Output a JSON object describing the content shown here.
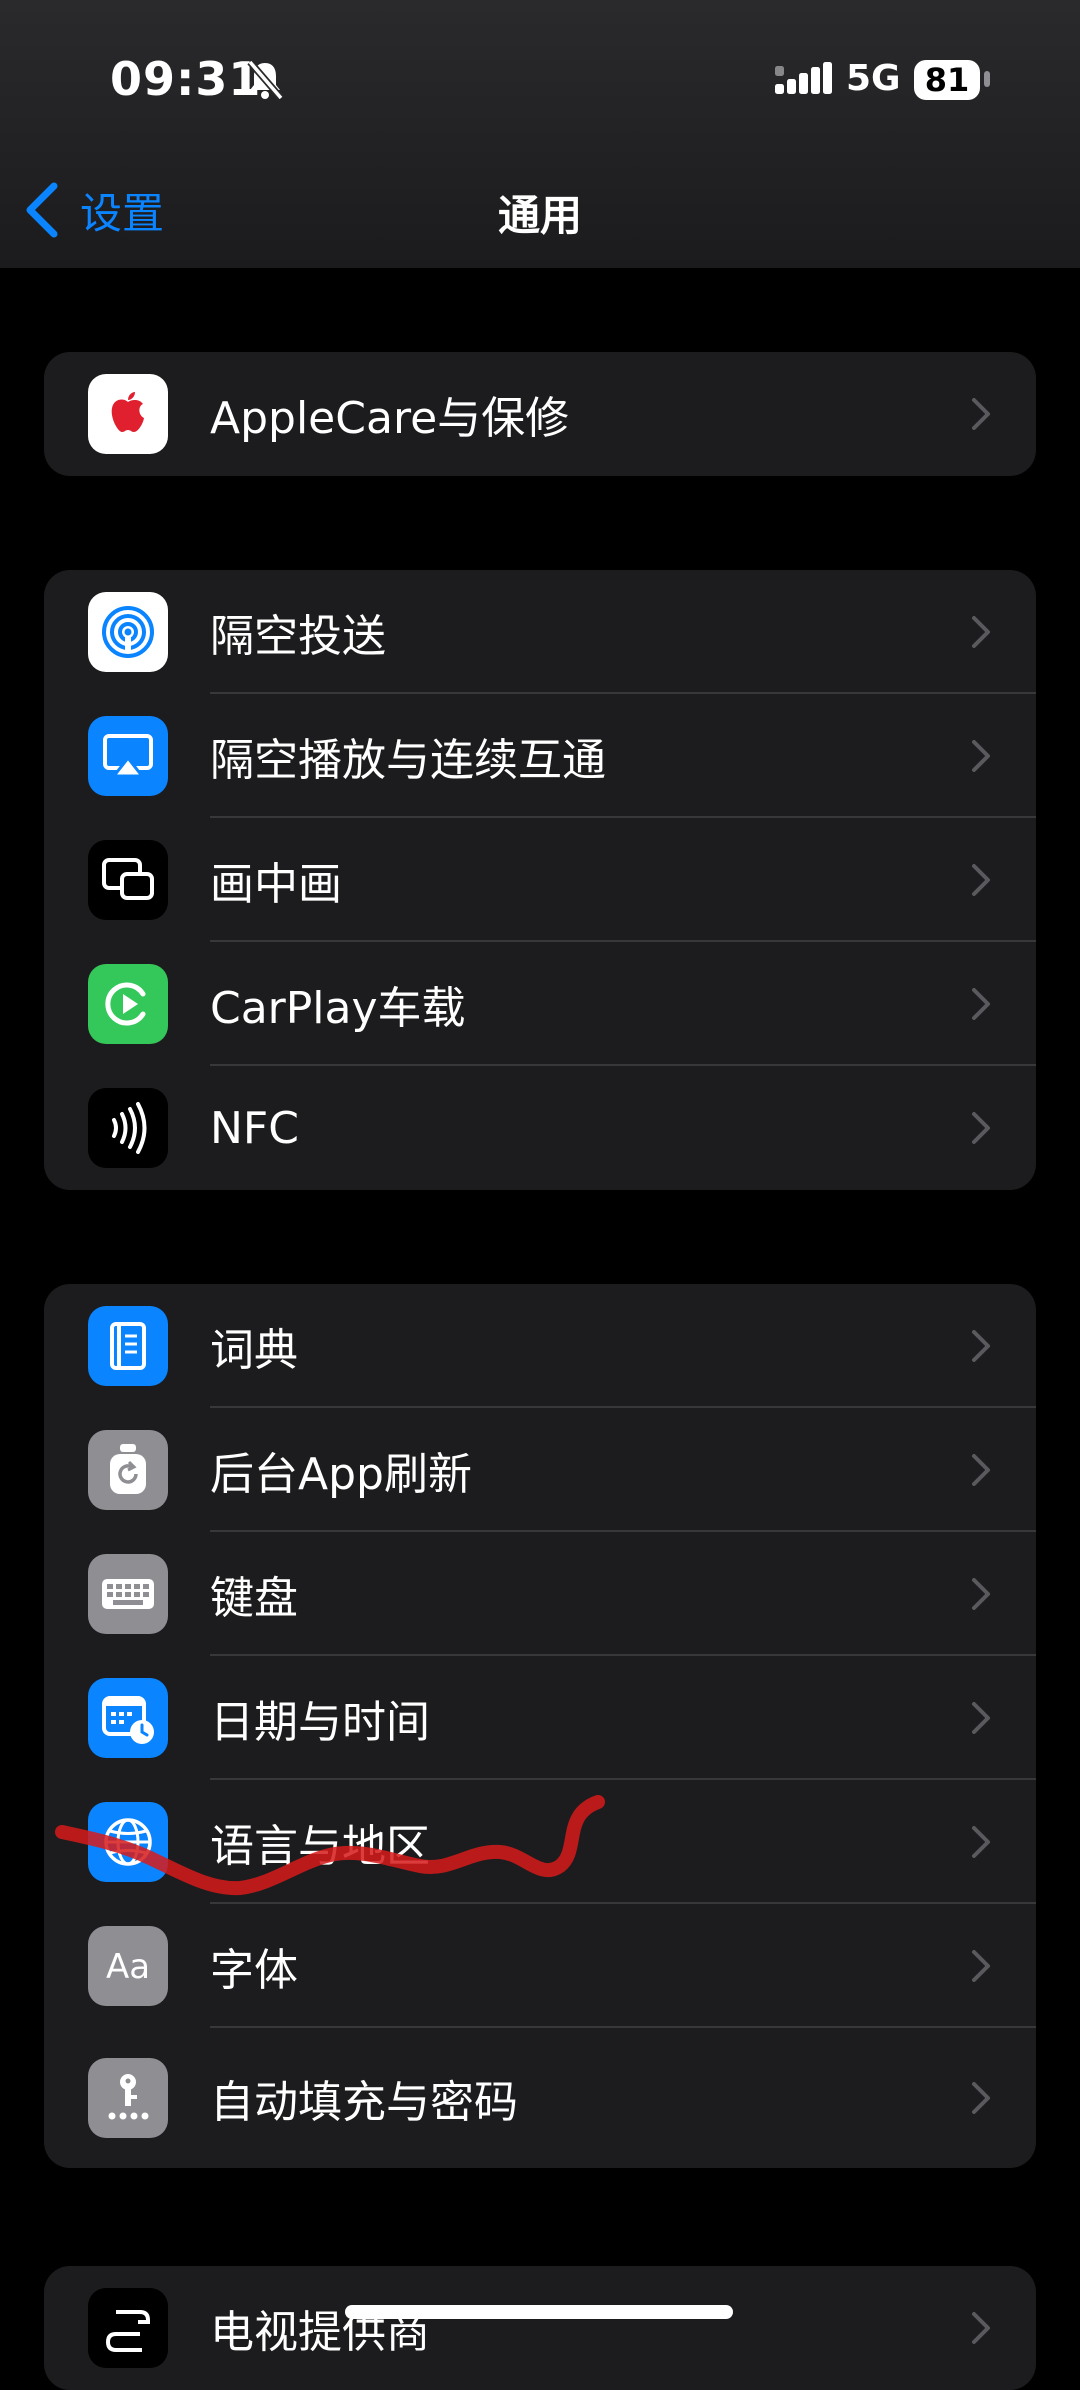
{
  "status_bar": {
    "time": "09:31",
    "network": "5G",
    "battery": "81"
  },
  "nav": {
    "back_label": "设置",
    "title": "通用"
  },
  "groups": [
    {
      "items": [
        {
          "label": "AppleCare与保修",
          "icon": "apple-logo-icon",
          "icon_bg": "#ffffff"
        }
      ]
    },
    {
      "items": [
        {
          "label": "隔空投送",
          "icon": "airdrop-icon",
          "icon_bg": "#ffffff"
        },
        {
          "label": "隔空播放与连续互通",
          "icon": "airplay-icon",
          "icon_bg": "#0a84ff"
        },
        {
          "label": "画中画",
          "icon": "picture-in-picture-icon",
          "icon_bg": "#000000"
        },
        {
          "label": "CarPlay车载",
          "icon": "carplay-icon",
          "icon_bg": "#34c759"
        },
        {
          "label": "NFC",
          "icon": "nfc-icon",
          "icon_bg": "#000000"
        }
      ]
    },
    {
      "items": [
        {
          "label": "词典",
          "icon": "dictionary-icon",
          "icon_bg": "#0a84ff"
        },
        {
          "label": "后台App刷新",
          "icon": "background-refresh-icon",
          "icon_bg": "#8e8e93"
        },
        {
          "label": "键盘",
          "icon": "keyboard-icon",
          "icon_bg": "#8e8e93"
        },
        {
          "label": "日期与时间",
          "icon": "date-time-icon",
          "icon_bg": "#0a84ff"
        },
        {
          "label": "语言与地区",
          "icon": "globe-icon",
          "icon_bg": "#0a84ff"
        },
        {
          "label": "字体",
          "icon": "fonts-icon",
          "icon_bg": "#8e8e93"
        },
        {
          "label": "自动填充与密码",
          "icon": "autofill-password-icon",
          "icon_bg": "#8e8e93"
        }
      ]
    },
    {
      "items": [
        {
          "label": "电视提供商",
          "icon": "tv-provider-icon",
          "icon_bg": "#000000"
        }
      ]
    }
  ],
  "colors": {
    "accent": "#0a84ff",
    "annotation_stroke": "#d71a1a"
  }
}
